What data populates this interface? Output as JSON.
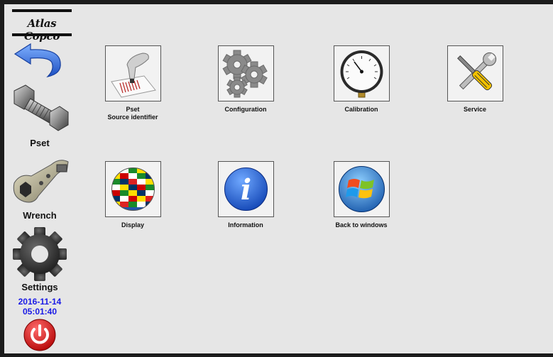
{
  "brand": {
    "name": "Atlas Copco"
  },
  "sidebar": {
    "back_icon": "back-arrow-icon",
    "items": [
      {
        "label": "Pset",
        "icon": "bolt-nut-icon"
      },
      {
        "label": "Wrench",
        "icon": "hydraulic-wrench-icon"
      },
      {
        "label": "Settings",
        "icon": "gear-icon"
      }
    ],
    "date": "2016-11-14",
    "time": "05:01:40",
    "power_icon": "power-icon"
  },
  "tiles": [
    {
      "label": "Pset\nSource identifier",
      "icon": "barcode-scanner-icon"
    },
    {
      "label": "Configuration",
      "icon": "gears-icon"
    },
    {
      "label": "Calibration",
      "icon": "pressure-gauge-icon"
    },
    {
      "label": "Service",
      "icon": "wrench-screwdriver-icon"
    },
    {
      "label": "Display",
      "icon": "flag-globe-icon"
    },
    {
      "label": "Information",
      "icon": "info-icon"
    },
    {
      "label": "Back to windows",
      "icon": "windows-logo-icon"
    }
  ],
  "colors": {
    "background": "#e6e6e6",
    "frame": "#1c1c1c",
    "datetime": "#1a1ae6",
    "power": "#e01818",
    "back_arrow": "#2f6fd8"
  }
}
